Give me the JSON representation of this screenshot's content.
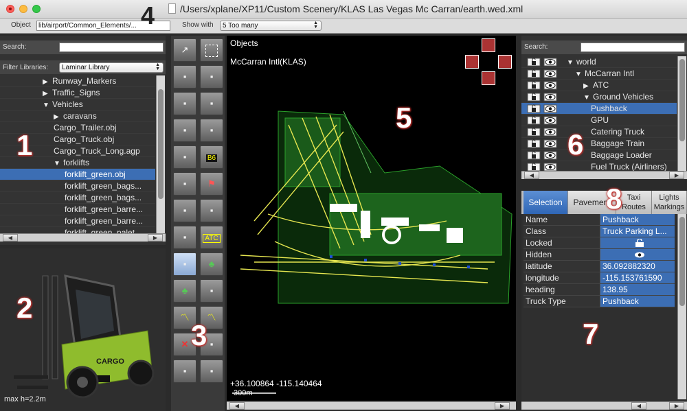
{
  "window": {
    "title": "/Users/xplane/XP11/Custom Scenery/KLAS Las Vegas Mc Carran/earth.wed.xml"
  },
  "toolbar": {
    "object_label": "Object",
    "object_value": "lib/airport/Common_Elements/...",
    "show_with_label": "Show with",
    "show_with_value": "5 Too many"
  },
  "library": {
    "search_label": "Search:",
    "filter_label": "Filter Libraries:",
    "filter_value": "Laminar Library",
    "items": [
      {
        "label": "Runway_Markers",
        "tri": "▶"
      },
      {
        "label": "Traffic_Signs",
        "tri": "▶"
      },
      {
        "label": "Vehicles",
        "tri": "▼"
      },
      {
        "label": "caravans",
        "tri": "▶"
      },
      {
        "label": "Cargo_Trailer.obj",
        "tri": ""
      },
      {
        "label": "Cargo_Truck.obj",
        "tri": ""
      },
      {
        "label": "Cargo_Truck_Long.agp",
        "tri": ""
      },
      {
        "label": "forklifts",
        "tri": "▼"
      },
      {
        "label": "forklift_green.obj",
        "tri": ""
      },
      {
        "label": "forklift_green_bags...",
        "tri": ""
      },
      {
        "label": "forklift_green_bags...",
        "tri": ""
      },
      {
        "label": "forklift_green_barre...",
        "tri": ""
      },
      {
        "label": "forklift_green_barre...",
        "tri": ""
      },
      {
        "label": "forklift_green_palet...",
        "tri": ""
      }
    ]
  },
  "preview": {
    "caption": "max h=2.2m",
    "vehicle_text": "CARGO"
  },
  "map": {
    "objects_label": "Objects",
    "airport_label": "McCarran Intl(KLAS)",
    "coords": "+36.100864 -115.140464",
    "scale_label": "300m"
  },
  "hierarchy": {
    "search_label": "Search:",
    "items": [
      {
        "label": "world",
        "tri": "▼"
      },
      {
        "label": "McCarran Intl",
        "tri": "▼"
      },
      {
        "label": "ATC",
        "tri": "▶"
      },
      {
        "label": "Ground Vehicles",
        "tri": "▼"
      },
      {
        "label": "Pushback",
        "tri": ""
      },
      {
        "label": "GPU",
        "tri": ""
      },
      {
        "label": "Catering Truck",
        "tri": ""
      },
      {
        "label": "Baggage Train",
        "tri": ""
      },
      {
        "label": "Baggage Loader",
        "tri": ""
      },
      {
        "label": "Fuel Truck (Airliners)",
        "tri": ""
      }
    ]
  },
  "tabs": [
    {
      "label": "Selection"
    },
    {
      "label": "Pavement"
    },
    {
      "label": "Taxi Routes"
    },
    {
      "label": "Lights Markings"
    }
  ],
  "properties": [
    {
      "key": "Name",
      "value": "Pushback"
    },
    {
      "key": "Class",
      "value": "Truck Parking L..."
    },
    {
      "key": "Locked",
      "value": ""
    },
    {
      "key": "Hidden",
      "value": ""
    },
    {
      "key": "latitude",
      "value": " 36.092882320"
    },
    {
      "key": "longitude",
      "value": "-115.153761590"
    },
    {
      "key": "heading",
      "value": "138.95"
    },
    {
      "key": "Truck Type",
      "value": "Pushback"
    }
  ],
  "tools": {
    "atc_label": "ATC",
    "sign_label": "B6"
  },
  "callouts": [
    "1",
    "2",
    "3",
    "4",
    "5",
    "6",
    "7",
    "8"
  ]
}
